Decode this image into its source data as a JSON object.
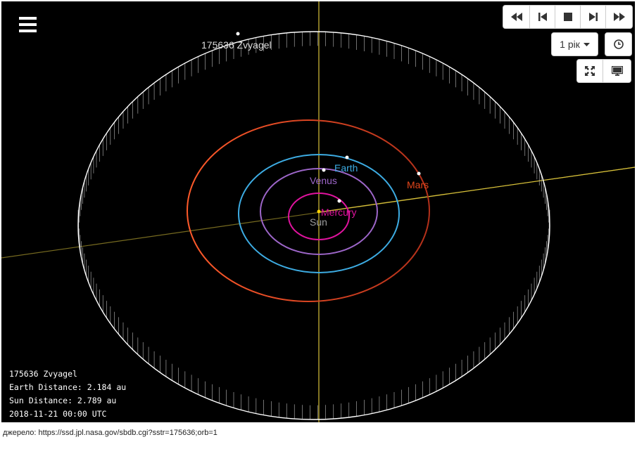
{
  "toolbar": {
    "rewind_icon": "fast-backward-icon",
    "step_back_icon": "step-backward-icon",
    "stop_icon": "stop-icon",
    "step_forward_icon": "step-forward-icon",
    "forward_icon": "fast-forward-icon",
    "step_size": "1 рік",
    "clock_icon": "clock-icon",
    "fullscreen_icon": "fullscreen-icon",
    "display_icon": "monitor-icon",
    "menu_icon": "hamburger-menu-icon"
  },
  "bodies": {
    "sun": "Sun",
    "mercury": "Mercury",
    "venus": "Venus",
    "earth": "Earth",
    "mars": "Mars",
    "asteroid": "175636 Zvyagel"
  },
  "colors": {
    "sun": "#9e9e9e",
    "mercury": "#e0139e",
    "venus": "#9d66c9",
    "earth": "#3dace3",
    "mars": "#e3461b",
    "asteroid": "#ffffff",
    "axis": "#d9c23a"
  },
  "info": {
    "name": "175636 Zvyagel",
    "earth_distance": "Earth Distance: 2.184 au",
    "sun_distance": "Sun Distance: 2.789 au",
    "datetime": "2018-11-21 00:00 UTC"
  },
  "source": "джерело: https://ssd.jpl.nasa.gov/sbdb.cgi?sstr=175636;orb=1"
}
